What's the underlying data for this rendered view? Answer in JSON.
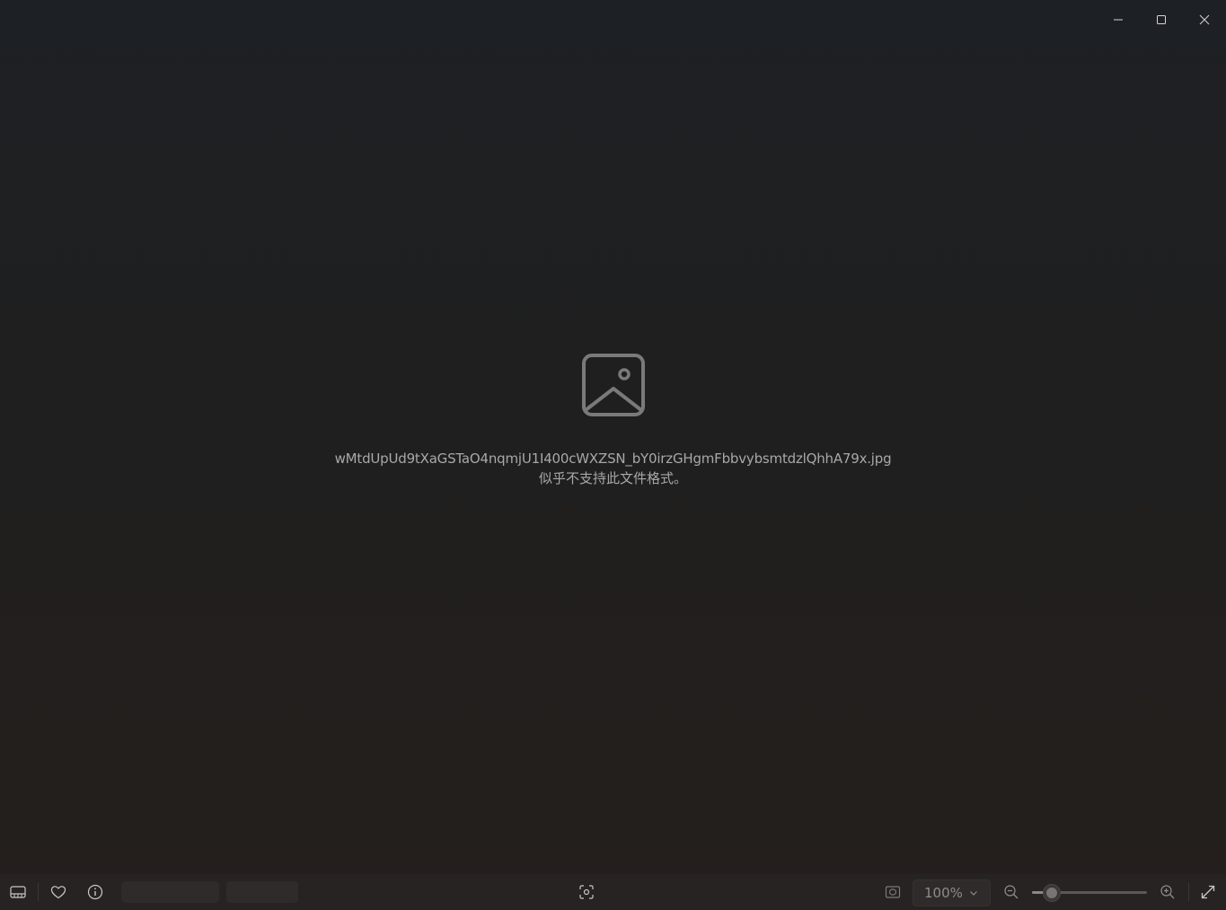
{
  "window": {
    "caption_buttons": [
      {
        "name": "minimize-button",
        "icon": "minimize-icon"
      },
      {
        "name": "maximize-button",
        "icon": "maximize-icon"
      },
      {
        "name": "close-button",
        "icon": "close-icon"
      }
    ]
  },
  "content": {
    "icon": "image-placeholder-icon",
    "filename": "wMtdUpUd9tXaGSTaO4nqmjU1I400cWXZSN_bY0irzGHgmFbbvybsmtdzlQhhA79x.jpg",
    "message": "似乎不支持此文件格式。"
  },
  "statusbar": {
    "zoom": {
      "value": "100%",
      "slider_fraction": 0.17
    }
  },
  "colors": {
    "background_top": "#1d2024",
    "background_bottom": "#241f1c",
    "statusbar": "#262322",
    "text": "#a8a8a8",
    "icon": "#c8c8c8"
  }
}
